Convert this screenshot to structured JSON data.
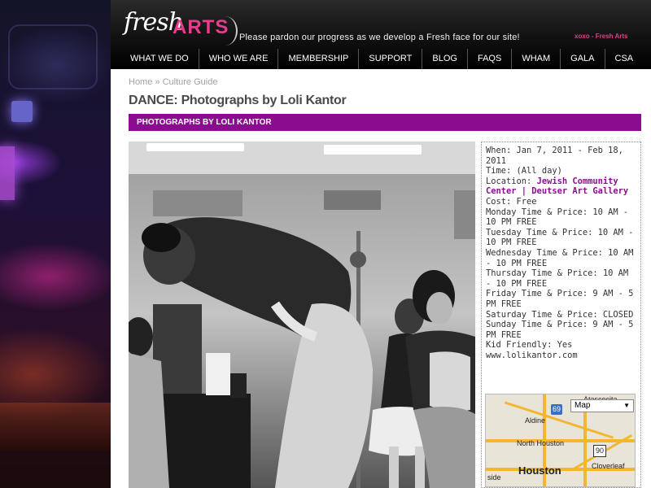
{
  "header": {
    "logo_fresh": "fresh",
    "logo_arts": "ARTS",
    "tagline": "Please pardon our progress as we develop a Fresh face for our site!",
    "signoff": "xoxo - Fresh Arts"
  },
  "nav": [
    "WHAT WE DO",
    "WHO WE ARE",
    "MEMBERSHIP",
    "SUPPORT",
    "BLOG",
    "FAQS",
    "WHAM",
    "GALA",
    "CSA"
  ],
  "breadcrumb": {
    "home": "Home",
    "sep": " » ",
    "current": "Culture Guide"
  },
  "page_title": "DANCE: Photographs by Loli Kantor",
  "section_bar": "PHOTOGRAPHS BY LOLI KANTOR",
  "info": {
    "when": "When: Jan 7, 2011 - Feb 18, 2011",
    "time": "Time: (All day)",
    "location_label": "Location: ",
    "location_value": "Jewish Community Center | Deutser Art Gallery",
    "cost": "Cost: Free",
    "schedule": [
      "Monday Time & Price: 10 AM - 10 PM FREE",
      "Tuesday Time & Price: 10 AM - 10 PM FREE",
      "Wednesday Time & Price: 10 AM - 10 PM FREE",
      "Thursday Time & Price: 10 AM - 10 PM FREE",
      "Friday Time & Price: 9 AM - 5 PM FREE",
      "Saturday Time & Price: CLOSED",
      "Sunday Time & Price: 9 AM - 5 PM FREE"
    ],
    "kid_friendly": "Kid Friendly: Yes",
    "website": "www.lolikantor.com"
  },
  "map": {
    "select_value": "Map",
    "labels": [
      "Atascocita",
      "Aldine",
      "North Houston",
      "Houston",
      "Cloverleaf",
      "side"
    ],
    "highways": [
      "69",
      "90"
    ]
  },
  "colors": {
    "accent": "#8b0d8f",
    "logo_pink": "#e83c8e"
  }
}
